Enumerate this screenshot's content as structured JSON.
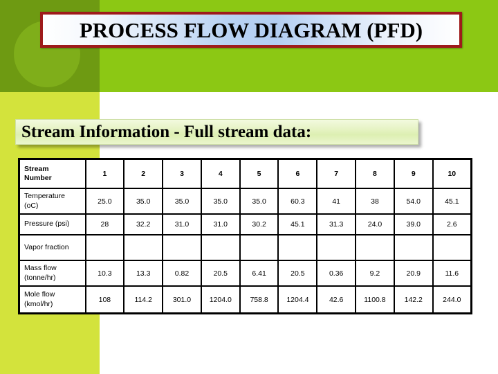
{
  "slide": {
    "title": "PROCESS FLOW DIAGRAM (PFD)",
    "subtitle": "Stream Information - Full stream data:"
  },
  "colors": {
    "olive_block": "#6E9A12",
    "olive_circle": "#7FAE1A",
    "green_band": "#8CC814",
    "yellow_column": "#D3E33C",
    "title_border": "#9E1B1B",
    "title_fill_light": "#FFFFFF",
    "title_fill_blue": "#B3CEF2",
    "subtitle_fill": "#E6F3C4",
    "table_border": "#000000",
    "table_background": "#FFFFFF"
  },
  "table": {
    "corner_label": "Stream Number",
    "columns": [
      "1",
      "2",
      "3",
      "4",
      "5",
      "6",
      "7",
      "8",
      "9",
      "10"
    ],
    "rows": [
      {
        "label": "Temperature (oC)",
        "label_line1": "Temperature",
        "label_line2": "(oC)",
        "values": [
          "25.0",
          "35.0",
          "35.0",
          "35.0",
          "35.0",
          "60.3",
          "41",
          "38",
          "54.0",
          "45.1"
        ]
      },
      {
        "label": "Pressure (psi)",
        "label_line1": "Pressure (psi)",
        "label_line2": "",
        "values": [
          "28",
          "32.2",
          "31.0",
          "31.0",
          "30.2",
          "45.1",
          "31.3",
          "24.0",
          "39.0",
          "2.6"
        ]
      },
      {
        "label": "Vapor fraction",
        "label_line1": "Vapor fraction",
        "label_line2": "",
        "values": [
          "",
          "",
          "",
          "",
          "",
          "",
          "",
          "",
          "",
          ""
        ]
      },
      {
        "label": "Mass flow (tonne/hr)",
        "label_line1": "Mass flow",
        "label_line2": "(tonne/hr)",
        "values": [
          "10.3",
          "13.3",
          "0.82",
          "20.5",
          "6.41",
          "20.5",
          "0.36",
          "9.2",
          "20.9",
          "11.6"
        ]
      },
      {
        "label": "Mole flow (kmol/hr)",
        "label_line1": "Mole flow",
        "label_line2": "(kmol/hr)",
        "values": [
          "108",
          "114.2",
          "301.0",
          "1204.0",
          "758.8",
          "1204.4",
          "42.6",
          "1100.8",
          "142.2",
          "244.0"
        ]
      }
    ]
  }
}
